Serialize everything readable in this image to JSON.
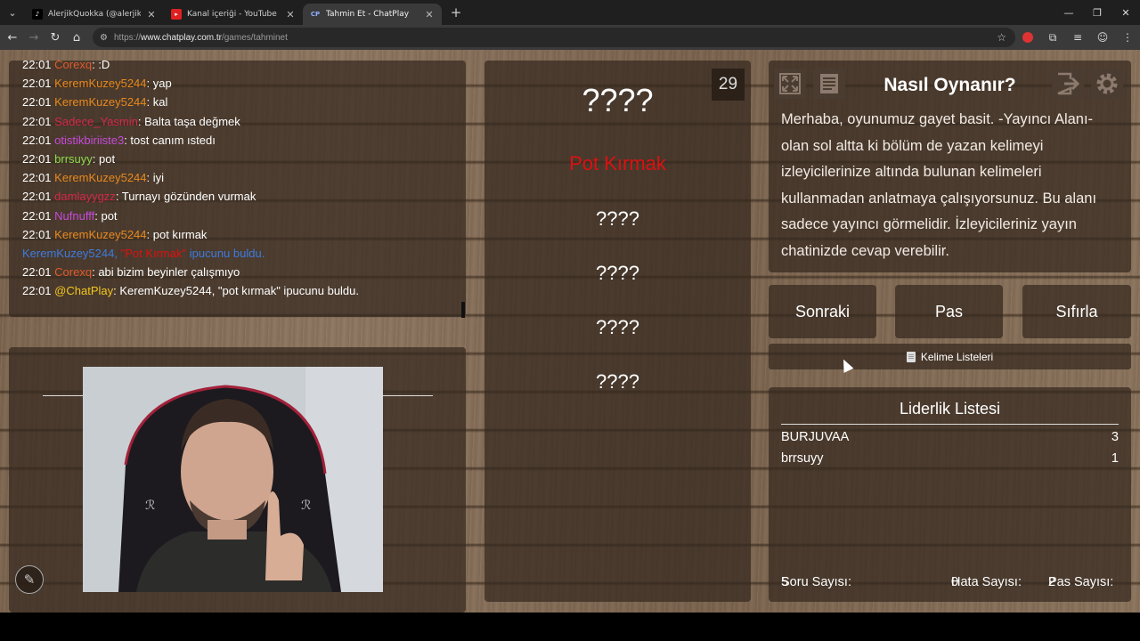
{
  "browser": {
    "tabs": [
      {
        "title": "AlerjikQuokka (@alerjikquokka)",
        "favicon": "tiktok-icon",
        "color": "#1f1f1f"
      },
      {
        "title": "Kanal içeriği - YouTube Studio",
        "favicon": "youtube-icon",
        "color": "#e02020"
      },
      {
        "title": "Tahmin Et - ChatPlay",
        "favicon": "CP",
        "color": "#3a5bd0"
      }
    ],
    "url_prefix": "https://",
    "url_host": "www.chatplay.com.tr",
    "url_path": "/games/tahminet"
  },
  "chat": {
    "messages": [
      {
        "time": "22:01",
        "user": "Corexq",
        "text": ": :D",
        "color": "#e05a2a"
      },
      {
        "time": "22:01",
        "user": "KeremKuzey5244",
        "text": ": yap",
        "color": "#e8881c"
      },
      {
        "time": "22:01",
        "user": "KeremKuzey5244",
        "text": ": kal",
        "color": "#e8881c"
      },
      {
        "time": "22:01",
        "user": "Sadece_Yasmin",
        "text": ": Balta taşa değmek",
        "color": "#d4284a"
      },
      {
        "time": "22:01",
        "user": "otistikbiriiste3",
        "text": ": tost canım ıstedı",
        "color": "#c84adb"
      },
      {
        "time": "22:01",
        "user": "brrsuyy",
        "text": ": pot",
        "color": "#8adb4a"
      },
      {
        "time": "22:01",
        "user": "KeremKuzey5244",
        "text": ": iyi",
        "color": "#e8881c"
      },
      {
        "time": "22:01",
        "user": "damlayygzz",
        "text": ": Turnayı gözünden vurmak",
        "color": "#d4284a"
      },
      {
        "time": "22:01",
        "user": "Nufnufff",
        "text": ": pot",
        "color": "#c84adb"
      },
      {
        "time": "22:01",
        "user": "KeremKuzey5244",
        "text": ": pot kırmak",
        "color": "#e8881c"
      },
      {
        "time": "22:01",
        "user": "Corexq",
        "text": ": abi bizim beyinler çalışmıyo",
        "color": "#e05a2a"
      },
      {
        "time": "22:01",
        "user": "@ChatPlay",
        "text": ": KeremKuzey5244, \"pot kırmak\" ipucunu buldu.",
        "color": "#f3c61e"
      }
    ],
    "system": {
      "user": "KeremKuzey5244,",
      "hint": "\"Pot Kırmak\"",
      "suffix": "ipucunu buldu."
    }
  },
  "game": {
    "timer": "29",
    "main_word": "????",
    "found_hint": "Pot Kırmak",
    "hidden_hints": [
      "????",
      "????",
      "????",
      "????"
    ]
  },
  "howto": {
    "title": "Nasıl Oynanır?",
    "text": "Merhaba, oyunumuz gayet basit. -Yayıncı Alanı- olan sol altta ki bölüm de yazan kelimeyi izleyicilerinize altında bulunan kelimeleri kullanmadan anlatmaya çalışıyorsunuz. Bu alanı sadece yayıncı görmelidir. İzleyicileriniz yayın chatinizde cevap verebilir."
  },
  "controls": {
    "next": "Sonraki",
    "pass": "Pas",
    "reset": "Sıfırla",
    "word_lists": "Kelime Listeleri"
  },
  "leaderboard": {
    "title": "Liderlik Listesi",
    "rows": [
      {
        "name": "BURJUVAA",
        "score": "3"
      },
      {
        "name": "brrsuyy",
        "score": "1"
      }
    ],
    "question_count_label": "Soru Sayısı:",
    "question_count": "5",
    "error_count_label": "Hata Sayısı:",
    "error_count": "0",
    "pass_count_label": "Pas Sayısı:",
    "pass_count": "2"
  }
}
